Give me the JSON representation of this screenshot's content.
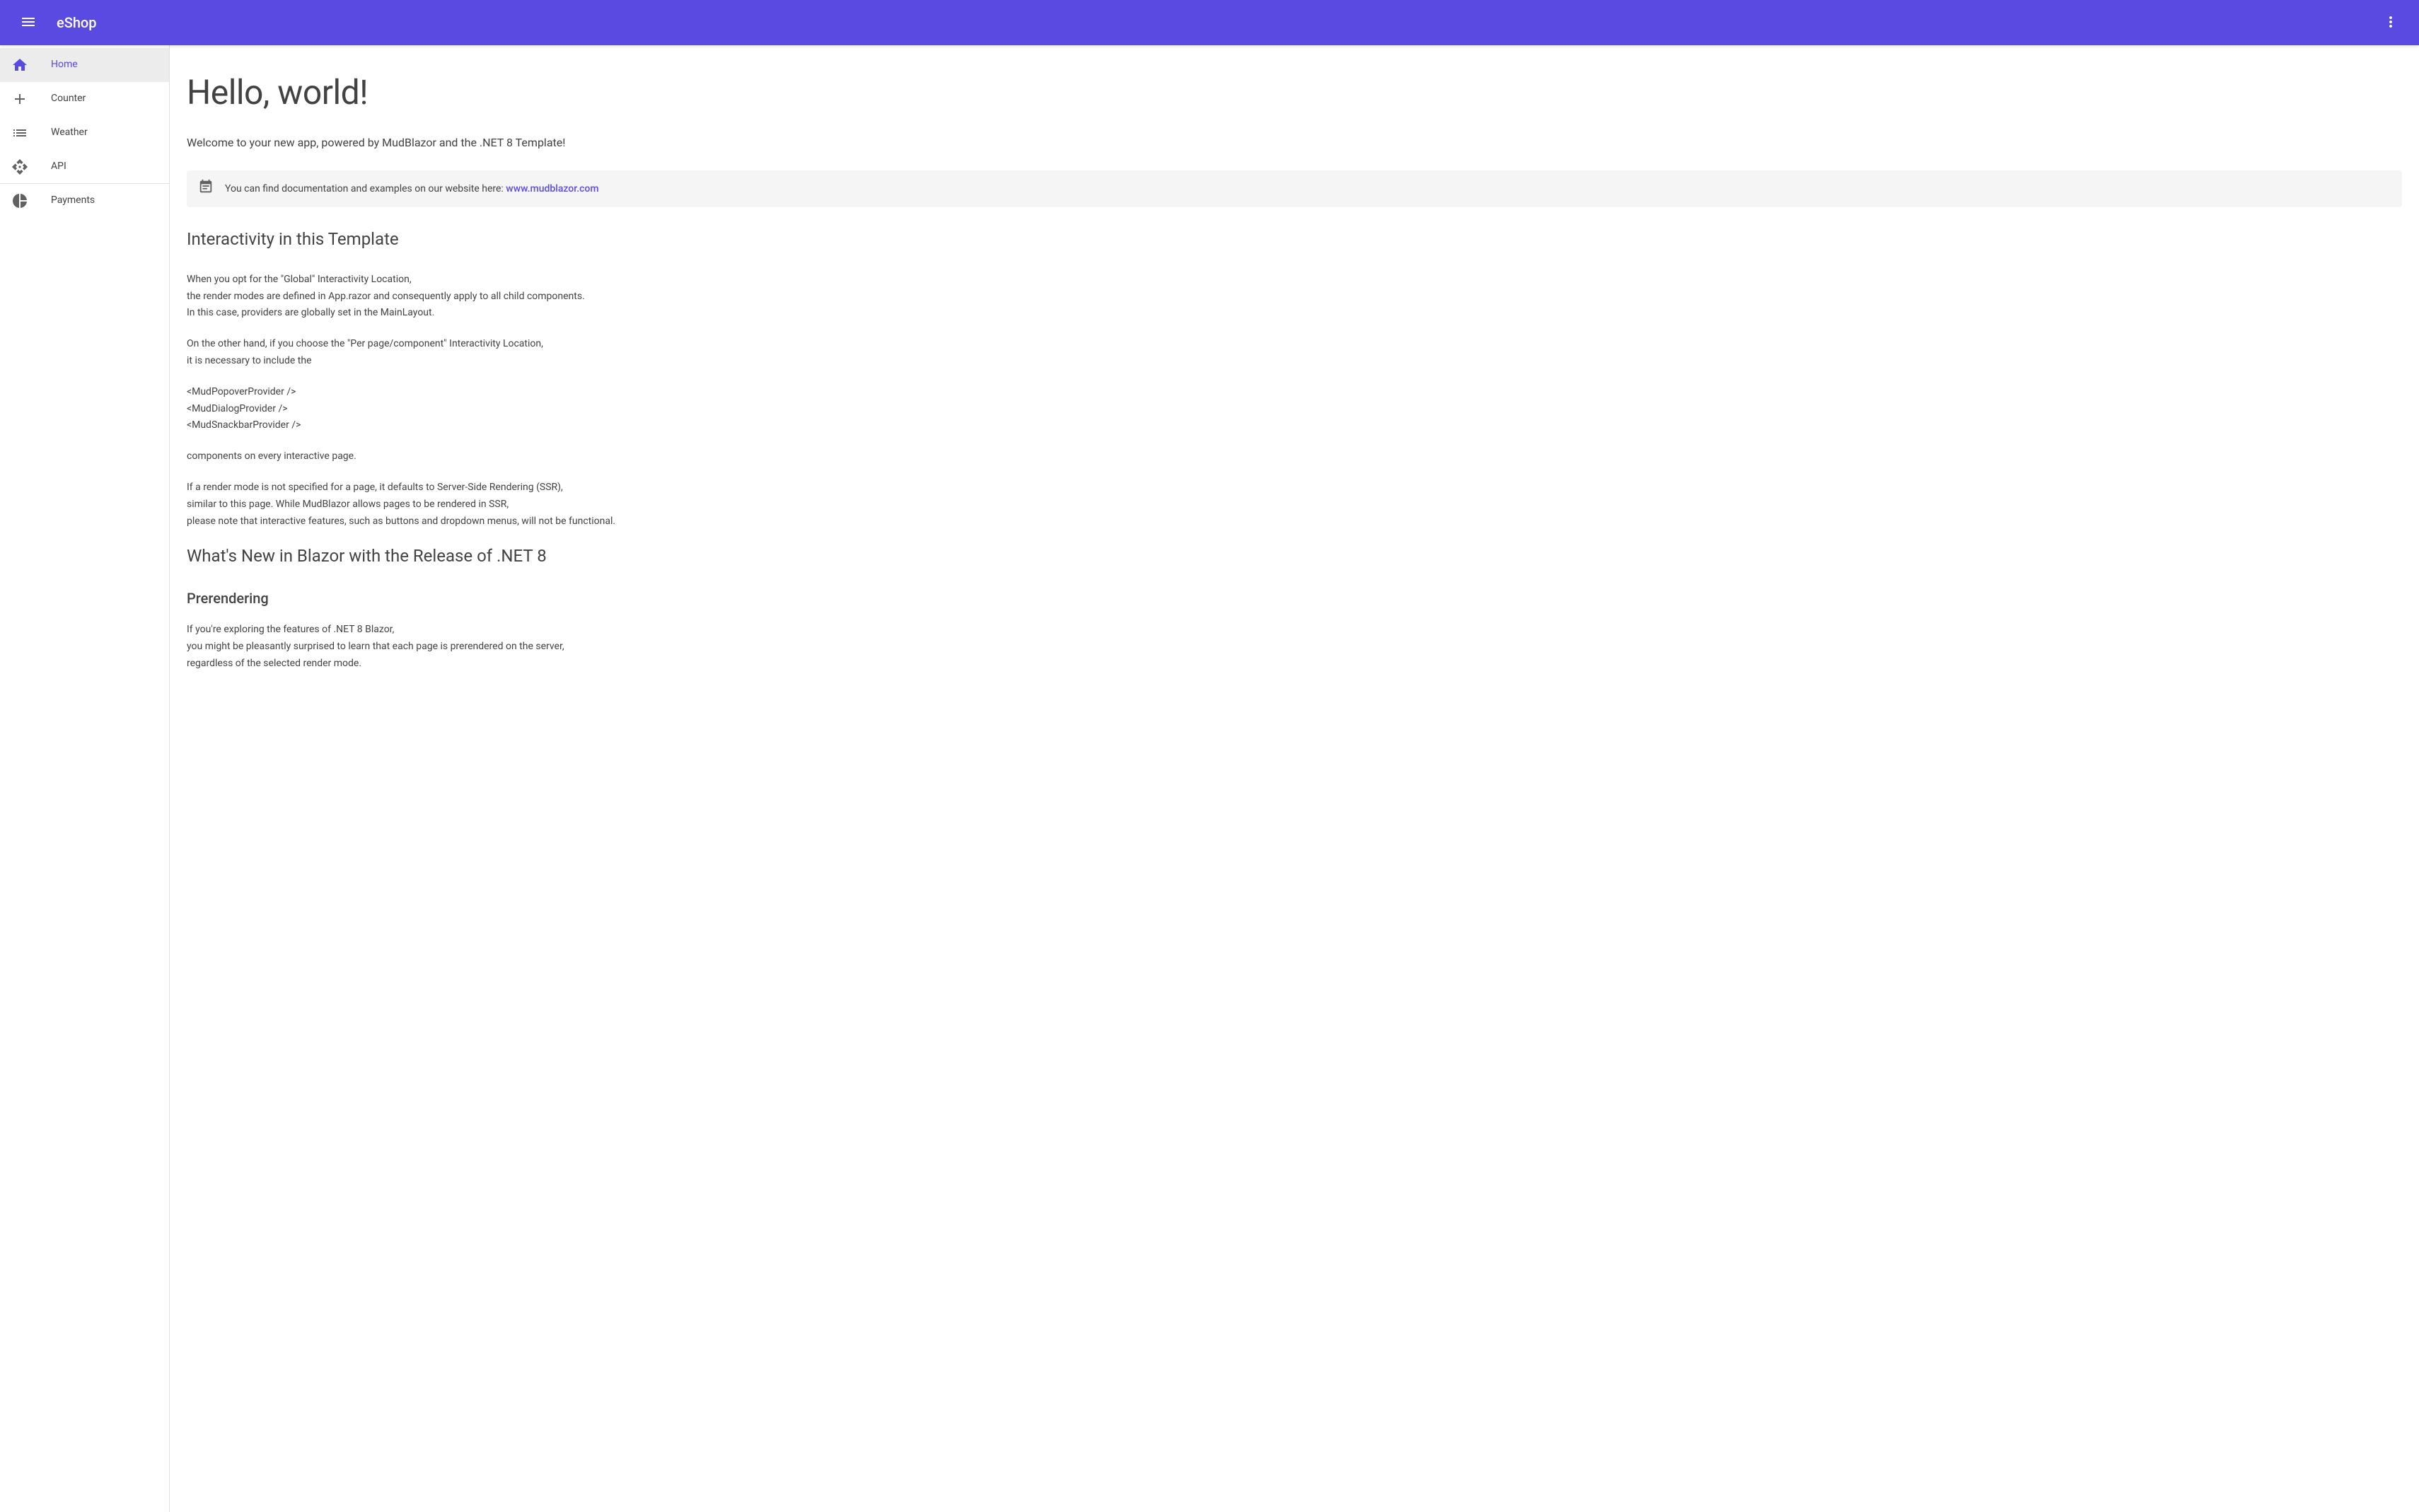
{
  "header": {
    "title": "eShop"
  },
  "sidebar": {
    "items": [
      {
        "label": "Home",
        "active": true
      },
      {
        "label": "Counter",
        "active": false
      },
      {
        "label": "Weather",
        "active": false
      },
      {
        "label": "API",
        "active": false
      },
      {
        "label": "Payments",
        "active": false
      }
    ]
  },
  "main": {
    "heading": "Hello, world!",
    "welcome": "Welcome to your new app, powered by MudBlazor and the .NET 8 Template!",
    "alert_text": "You can find documentation and examples on our website here: ",
    "alert_link_text": "www.mudblazor.com",
    "section1_title": "Interactivity in this Template",
    "para1": "When you opt for the \"Global\" Interactivity Location,\nthe render modes are defined in App.razor and consequently apply to all child components.\nIn this case, providers are globally set in the MainLayout.",
    "para2": "On the other hand, if you choose the \"Per page/component\" Interactivity Location,\nit is necessary to include the",
    "para3": "<MudPopoverProvider />\n<MudDialogProvider />\n<MudSnackbarProvider />",
    "para4": "components on every interactive page.",
    "para5": "If a render mode is not specified for a page, it defaults to Server-Side Rendering (SSR),\nsimilar to this page. While MudBlazor allows pages to be rendered in SSR,\nplease note that interactive features, such as buttons and dropdown menus, will not be functional.",
    "section2_title": "What's New in Blazor with the Release of .NET 8",
    "section3_title": "Prerendering",
    "para6": "If you're exploring the features of .NET 8 Blazor,\nyou might be pleasantly surprised to learn that each page is prerendered on the server,\nregardless of the selected render mode."
  }
}
